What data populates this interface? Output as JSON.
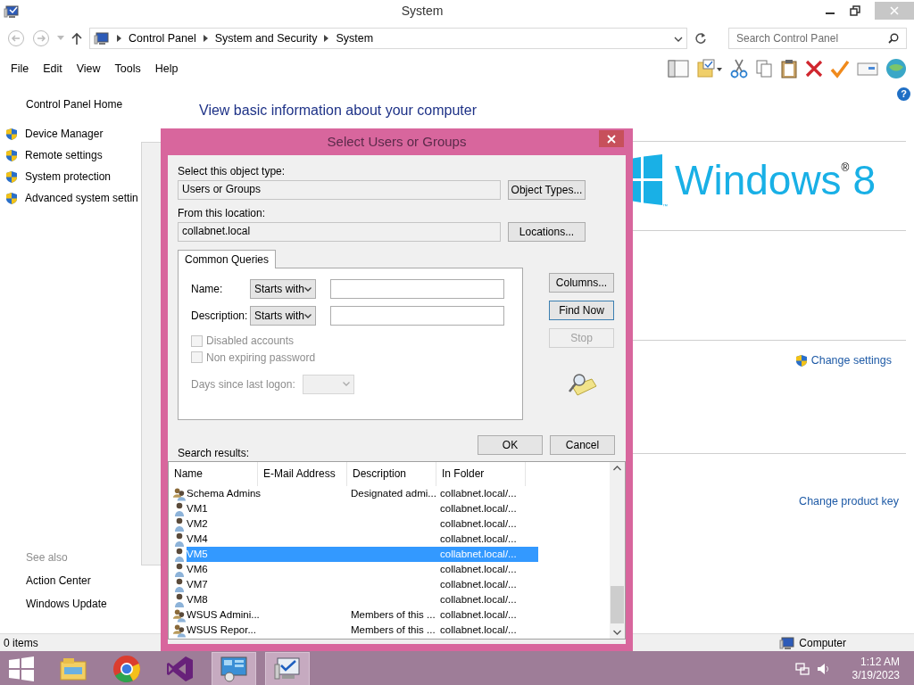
{
  "window": {
    "title": "System"
  },
  "address": {
    "crumbs": [
      "Control Panel",
      "System and Security",
      "System"
    ],
    "search_placeholder": "Search Control Panel"
  },
  "menu": [
    "File",
    "Edit",
    "View",
    "Tools",
    "Help"
  ],
  "help_glyph": "?",
  "sidebar": {
    "home": "Control Panel Home",
    "links": [
      "Device Manager",
      "Remote settings",
      "System protection",
      "Advanced system settin"
    ],
    "see_also": "See also",
    "see_also_links": [
      "Action Center",
      "Windows Update"
    ]
  },
  "main": {
    "heading": "View basic information about your computer",
    "logo": {
      "word": "Windows",
      "mark": "®",
      "version": "8",
      "tm": "™"
    },
    "change_settings": "Change settings",
    "change_product_key": "Change product key"
  },
  "status_bar": {
    "items": "0 items",
    "computer": "Computer"
  },
  "dialog": {
    "title": "Select Users or Groups",
    "object_type_label": "Select this object type:",
    "object_type": "Users or Groups",
    "object_types_button": "Object Types...",
    "location_label": "From this location:",
    "location": "collabnet.local",
    "locations_button": "Locations...",
    "tabs": [
      {
        "label": "Common Queries",
        "selected": true
      }
    ],
    "queries": [
      {
        "label": "Name:",
        "operator": "Starts with"
      },
      {
        "label": "Description:",
        "operator": "Starts with"
      }
    ],
    "checkboxes": [
      {
        "label": "Disabled accounts",
        "checked": false,
        "disabled": true
      },
      {
        "label": "Non expiring password",
        "checked": false,
        "disabled": true
      }
    ],
    "days_label": "Days since last logon:",
    "side_buttons": [
      {
        "label": "Columns...",
        "disabled": false,
        "default": false
      },
      {
        "label": "Find Now",
        "disabled": false,
        "default": true
      },
      {
        "label": "Stop",
        "disabled": true,
        "default": false
      }
    ],
    "ok": "OK",
    "cancel": "Cancel",
    "results_label": "Search results:",
    "columns": [
      "Name",
      "E-Mail Address",
      "Description",
      "In Folder"
    ],
    "rows": [
      {
        "kind": "group",
        "name": "Schema Admins",
        "description": "Designated admi...",
        "folder": "collabnet.local/...",
        "selected": false
      },
      {
        "kind": "user",
        "name": "VM1",
        "folder": "collabnet.local/...",
        "selected": false
      },
      {
        "kind": "user",
        "name": "VM2",
        "folder": "collabnet.local/...",
        "selected": false
      },
      {
        "kind": "user",
        "name": "VM4",
        "folder": "collabnet.local/...",
        "selected": false
      },
      {
        "kind": "user",
        "name": "VM5",
        "folder": "collabnet.local/...",
        "selected": true
      },
      {
        "kind": "user",
        "name": "VM6",
        "folder": "collabnet.local/...",
        "selected": false
      },
      {
        "kind": "user",
        "name": "VM7",
        "folder": "collabnet.local/...",
        "selected": false
      },
      {
        "kind": "user",
        "name": "VM8",
        "folder": "collabnet.local/...",
        "selected": false
      },
      {
        "kind": "group",
        "name": "WSUS Admini...",
        "description": "Members of this ...",
        "folder": "collabnet.local/...",
        "selected": false
      },
      {
        "kind": "group",
        "name": "WSUS Repor...",
        "description": "Members of this ...",
        "folder": "collabnet.local/...",
        "selected": false
      }
    ]
  },
  "taskbar": {
    "apps": [
      {
        "kind": "explorer",
        "open": false
      },
      {
        "kind": "chrome",
        "open": false
      },
      {
        "kind": "studio",
        "open": false
      },
      {
        "kind": "control",
        "open": true
      },
      {
        "kind": "system",
        "open": true
      }
    ],
    "time": "1:12 AM",
    "date": "3/19/2023"
  }
}
